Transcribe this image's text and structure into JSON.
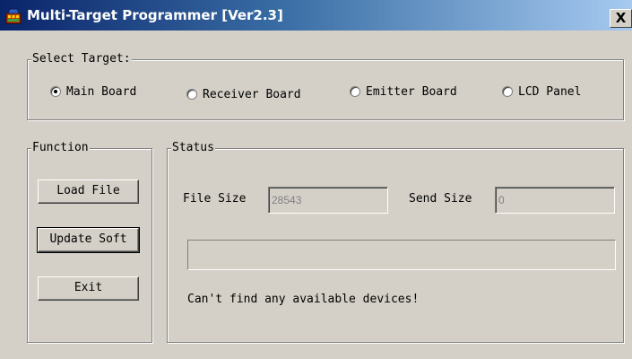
{
  "window": {
    "title": "Multi-Target Programmer [Ver2.3]",
    "close_label": "X"
  },
  "select_target": {
    "legend": "Select Target:",
    "options": [
      {
        "label": "Main Board",
        "selected": true
      },
      {
        "label": "Receiver Board",
        "selected": false
      },
      {
        "label": "Emitter Board",
        "selected": false
      },
      {
        "label": "LCD Panel",
        "selected": false
      }
    ]
  },
  "function": {
    "legend": "Function",
    "load_file_label": "Load File",
    "update_soft_label": "Update Soft",
    "exit_label": "Exit"
  },
  "status": {
    "legend": "Status",
    "file_size_label": "File Size",
    "file_size_value": "28543",
    "send_size_label": "Send Size",
    "send_size_value": "0",
    "progress": 0,
    "message": "Can't find any available devices!"
  },
  "colors": {
    "face": "#d4d0c8",
    "title_start": "#0a246a",
    "title_end": "#a6caf0"
  }
}
